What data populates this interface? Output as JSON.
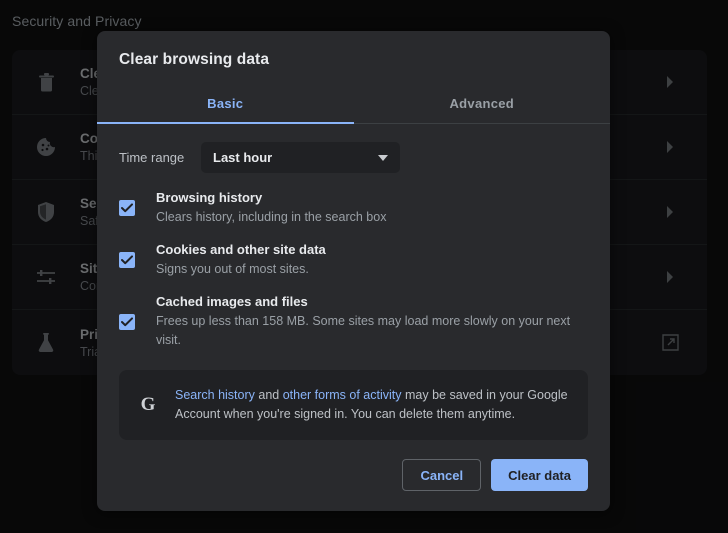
{
  "background": {
    "page_title": "Security and Privacy",
    "rows": [
      {
        "icon": "trash-icon",
        "title": "Clear browsing data",
        "subtitle": "Clear history, cookies, cache, and more",
        "action": "chevron-right-icon"
      },
      {
        "icon": "cookie-icon",
        "title": "Cookies and other site data",
        "subtitle": "Third-party cookies are blocked",
        "action": "chevron-right-icon"
      },
      {
        "icon": "shield-icon",
        "title": "Security",
        "subtitle": "Safe Browsing and other security settings",
        "action": "chevron-right-icon"
      },
      {
        "icon": "sliders-icon",
        "title": "Site Settings",
        "subtitle": "Controls what information sites can use and show",
        "action": "chevron-right-icon"
      },
      {
        "icon": "flask-icon",
        "title": "Privacy Sandbox",
        "subtitle": "Trial features are on",
        "action": "external-link-icon"
      }
    ]
  },
  "dialog": {
    "title": "Clear browsing data",
    "tabs": [
      {
        "label": "Basic",
        "active": true
      },
      {
        "label": "Advanced",
        "active": false
      }
    ],
    "time_range": {
      "label": "Time range",
      "value": "Last hour",
      "arrow_icon": "chevron-down-icon"
    },
    "options": [
      {
        "checked": true,
        "title": "Browsing history",
        "description": "Clears history, including in the search box"
      },
      {
        "checked": true,
        "title": "Cookies and other site data",
        "description": "Signs you out of most sites."
      },
      {
        "checked": true,
        "title": "Cached images and files",
        "description": "Frees up less than 158 MB. Some sites may load more slowly on your next visit."
      }
    ],
    "notice": {
      "icon": "google-g-icon",
      "link1": "Search history",
      "mid": " and ",
      "link2": "other forms of activity",
      "rest": " may be saved in your Google Account when you're signed in. You can delete them anytime."
    },
    "buttons": {
      "cancel": "Cancel",
      "confirm": "Clear data"
    }
  },
  "colors": {
    "accent": "#8ab4f8",
    "dialog_bg": "#292a2d",
    "page_bg": "#0e0e0f",
    "card_bg": "#17181a",
    "inset_bg": "#202124"
  }
}
